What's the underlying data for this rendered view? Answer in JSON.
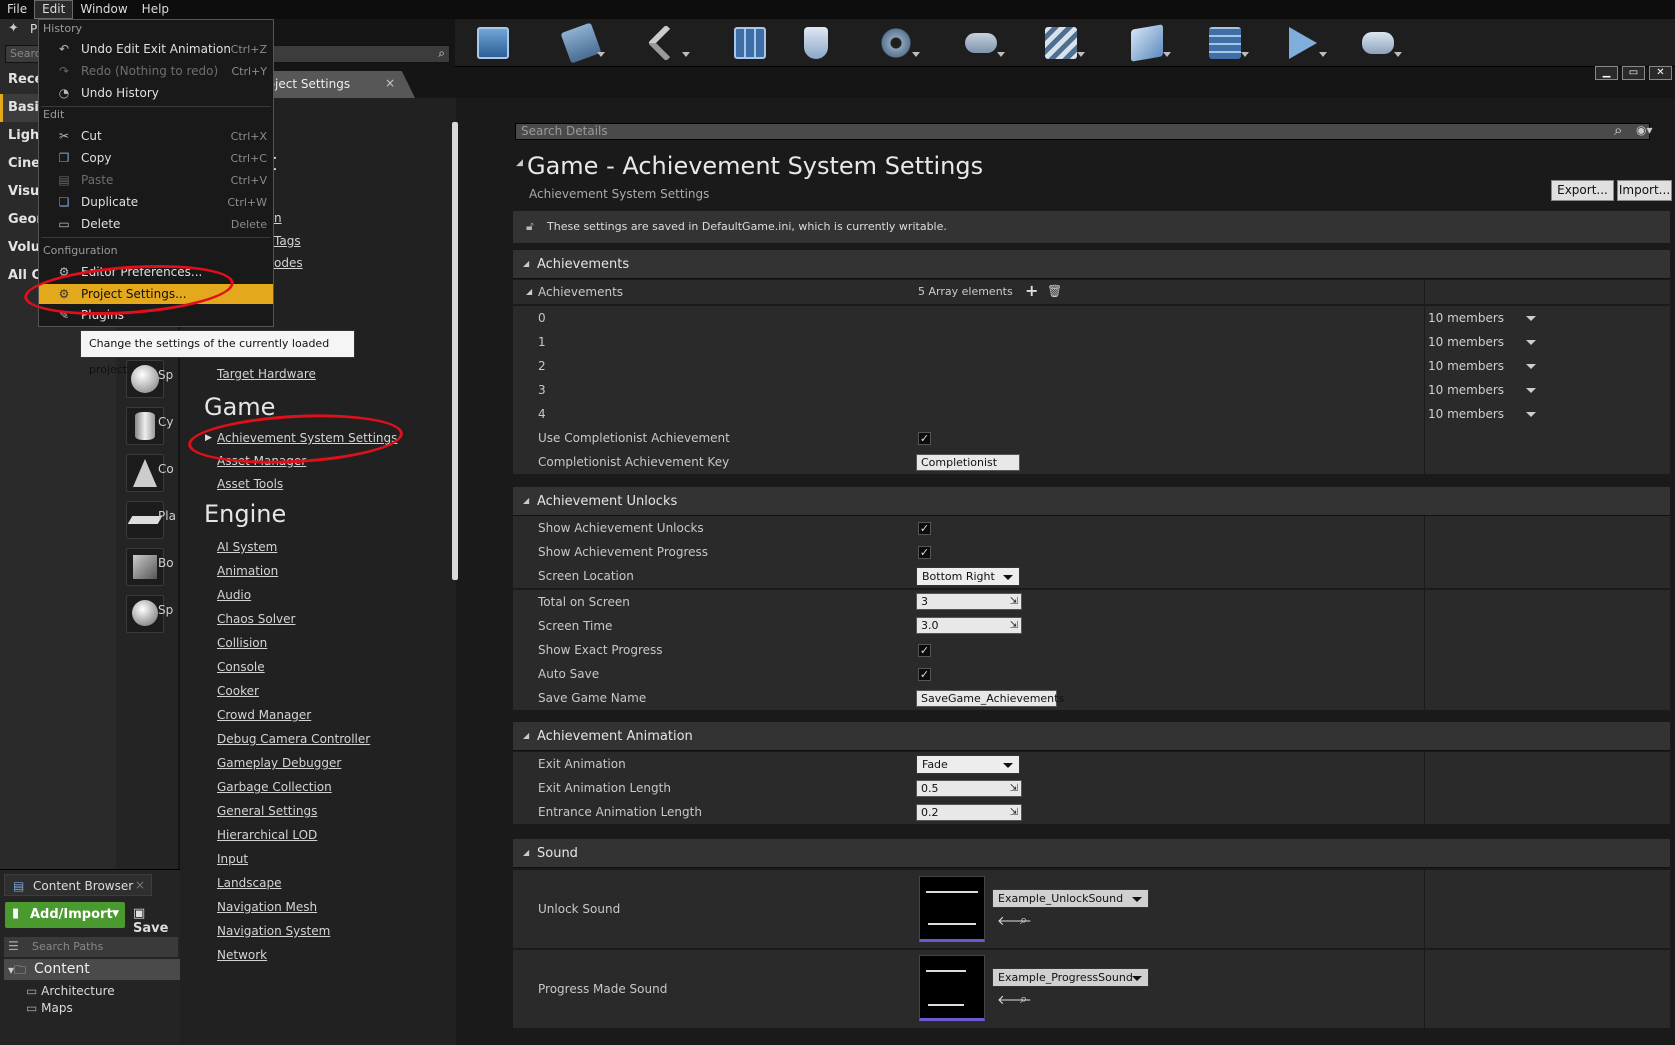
{
  "menubar": [
    "File",
    "Edit",
    "Window",
    "Help"
  ],
  "modes": {
    "title": "P",
    "search_placeholder": "Searc",
    "categories": [
      "Recen",
      "Basic",
      "Lights",
      "Ciner",
      "Visua",
      "Geom",
      "Volun",
      "All Cl"
    ],
    "shapes": [
      "Sp",
      "Cy",
      "Co",
      "Pla",
      "Bo",
      "Sp"
    ]
  },
  "content_browser": {
    "tab": "Content Browser",
    "add_import": "Add/Import",
    "save": "Save",
    "search_paths": "Search Paths",
    "tree": [
      "Content",
      "Architecture",
      "Maps"
    ]
  },
  "edit_menu": {
    "sections": [
      "History",
      "Edit",
      "Configuration"
    ],
    "history": [
      {
        "icon": "undo-icon",
        "label": "Undo Edit Exit Animation",
        "shortcut": "Ctrl+Z",
        "enabled": true
      },
      {
        "icon": "redo-icon",
        "label": "Redo (Nothing to redo)",
        "shortcut": "Ctrl+Y",
        "enabled": false
      },
      {
        "icon": "history-icon",
        "label": "Undo History",
        "shortcut": "",
        "enabled": true
      }
    ],
    "edit": [
      {
        "icon": "cut-icon",
        "label": "Cut",
        "shortcut": "Ctrl+X",
        "enabled": true
      },
      {
        "icon": "copy-icon",
        "label": "Copy",
        "shortcut": "Ctrl+C",
        "enabled": true
      },
      {
        "icon": "paste-icon",
        "label": "Paste",
        "shortcut": "Ctrl+V",
        "enabled": false
      },
      {
        "icon": "duplicate-icon",
        "label": "Duplicate",
        "shortcut": "Ctrl+W",
        "enabled": true
      },
      {
        "icon": "delete-icon",
        "label": "Delete",
        "shortcut": "Delete",
        "enabled": true
      }
    ],
    "configuration": [
      {
        "icon": "prefs-icon",
        "label": "Editor Preferences...",
        "shortcut": ""
      },
      {
        "icon": "gear-icon",
        "label": "Project Settings...",
        "shortcut": ""
      },
      {
        "icon": "plugin-icon",
        "label": "Plugins",
        "shortcut": ""
      }
    ],
    "tooltip": "Change the settings of the currently loaded project."
  },
  "project_settings": {
    "tab": "Project Settings",
    "nav": {
      "partial": [
        "s",
        "t",
        "n",
        "Tags",
        "odes"
      ],
      "target_hardware": "Target Hardware",
      "game_header": "Game",
      "game": [
        "Achievement System Settings",
        "Asset Manager",
        "Asset Tools"
      ],
      "engine_header": "Engine",
      "engine": [
        "AI System",
        "Animation",
        "Audio",
        "Chaos Solver",
        "Collision",
        "Console",
        "Cooker",
        "Crowd Manager",
        "Debug Camera Controller",
        "Gameplay Debugger",
        "Garbage Collection",
        "General Settings",
        "Hierarchical LOD",
        "Input",
        "Landscape",
        "Navigation Mesh",
        "Navigation System",
        "Network"
      ]
    },
    "details": {
      "search_placeholder": "Search Details",
      "title": "Game - Achievement System Settings",
      "subtitle": "Achievement System Settings",
      "export": "Export...",
      "import": "Import...",
      "notice": "These settings are saved in DefaultGame.ini, which is currently writable.",
      "achievements_section": "Achievements",
      "achievements_label": "Achievements",
      "array_count": "5 Array elements",
      "array_items": [
        {
          "index": "0",
          "value": "10 members"
        },
        {
          "index": "1",
          "value": "10 members"
        },
        {
          "index": "2",
          "value": "10 members"
        },
        {
          "index": "3",
          "value": "10 members"
        },
        {
          "index": "4",
          "value": "10 members"
        }
      ],
      "use_completionist": "Use Completionist Achievement",
      "completionist_key": "Completionist Achievement Key",
      "completionist_key_value": "Completionist",
      "unlocks_section": "Achievement Unlocks",
      "show_unlocks": "Show Achievement Unlocks",
      "show_progress": "Show Achievement Progress",
      "screen_location": "Screen Location",
      "screen_location_value": "Bottom Right",
      "total_on_screen": "Total on Screen",
      "total_on_screen_value": "3",
      "screen_time": "Screen Time",
      "screen_time_value": "3.0",
      "show_exact_progress": "Show Exact Progress",
      "auto_save": "Auto Save",
      "save_game_name": "Save Game Name",
      "save_game_name_value": "SaveGame_Achievements",
      "animation_section": "Achievement Animation",
      "exit_animation": "Exit Animation",
      "exit_animation_value": "Fade",
      "exit_animation_length": "Exit Animation Length",
      "exit_animation_length_value": "0.5",
      "entrance_animation_length": "Entrance Animation Length",
      "entrance_animation_length_value": "0.2",
      "sound_section": "Sound",
      "unlock_sound": "Unlock Sound",
      "unlock_sound_value": "Example_UnlockSound",
      "progress_sound": "Progress Made Sound",
      "progress_sound_value": "Example_ProgressSound"
    }
  },
  "colors": {
    "highlight": "#e3a81b",
    "annotation": "#e0101a",
    "accent_green": "#5aa83a"
  }
}
